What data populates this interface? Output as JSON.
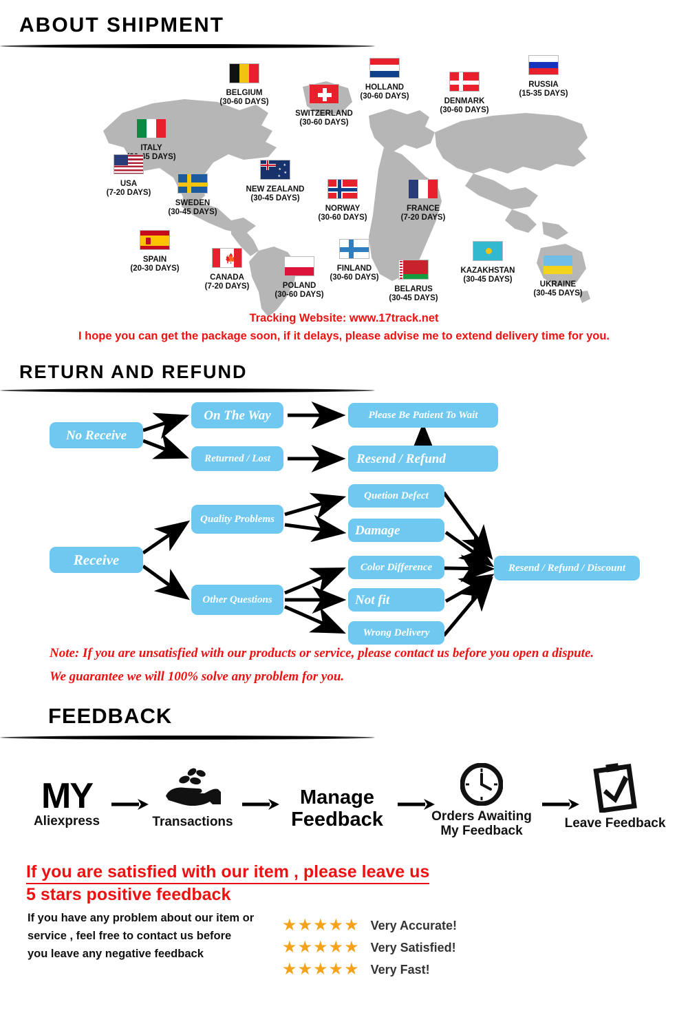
{
  "sections": {
    "shipment_title": "ABOUT  SHIPMENT",
    "return_title": "RETURN AND REFUND",
    "feedback_title": "FEEDBACK"
  },
  "map": {
    "countries": [
      {
        "name": "ITALY",
        "days": "(30-45 DAYS)",
        "flag": "italy"
      },
      {
        "name": "BELGIUM",
        "days": "(30-60 DAYS)",
        "flag": "belgium"
      },
      {
        "name": "SWITZERLAND",
        "days": "(30-60 DAYS)",
        "flag": "switzerland"
      },
      {
        "name": "HOLLAND",
        "days": "(30-60 DAYS)",
        "flag": "holland"
      },
      {
        "name": "DENMARK",
        "days": "(30-60 DAYS)",
        "flag": "denmark"
      },
      {
        "name": "RUSSIA",
        "days": "(15-35 DAYS)",
        "flag": "russia"
      },
      {
        "name": "USA",
        "days": "(7-20 DAYS)",
        "flag": "usa"
      },
      {
        "name": "SWEDEN",
        "days": "(30-45 DAYS)",
        "flag": "sweden"
      },
      {
        "name": "NEW ZEALAND",
        "days": "(30-45 DAYS)",
        "flag": "new-zealand"
      },
      {
        "name": "NORWAY",
        "days": "(30-60 DAYS)",
        "flag": "norway"
      },
      {
        "name": "FRANCE",
        "days": "(7-20 DAYS)",
        "flag": "france"
      },
      {
        "name": "SPAIN",
        "days": "(20-30 DAYS)",
        "flag": "spain"
      },
      {
        "name": "CANADA",
        "days": "(7-20 DAYS)",
        "flag": "canada"
      },
      {
        "name": "POLAND",
        "days": "(30-60 DAYS)",
        "flag": "poland"
      },
      {
        "name": "FINLAND",
        "days": "(30-60 DAYS)",
        "flag": "finland"
      },
      {
        "name": "BELARUS",
        "days": "(30-45 DAYS)",
        "flag": "belarus"
      },
      {
        "name": "KAZAKHSTAN",
        "days": "(30-45 DAYS)",
        "flag": "kazakhstan"
      },
      {
        "name": "UKRAINE",
        "days": "(30-45 DAYS)",
        "flag": "ukraine"
      }
    ],
    "tracking_line": "Tracking Website: www.17track.net",
    "hope_line": "I hope you can get the package soon, if it delays, please advise me to extend delivery time for you."
  },
  "flow": {
    "nodes": [
      {
        "id": "no-receive",
        "label": "No Receive"
      },
      {
        "id": "on-the-way",
        "label": "On The Way"
      },
      {
        "id": "returned-lost",
        "label": "Returned / Lost"
      },
      {
        "id": "be-patient",
        "label": "Please Be Patient To Wait"
      },
      {
        "id": "resend-refund",
        "label": "Resend / Refund"
      },
      {
        "id": "receive",
        "label": "Receive"
      },
      {
        "id": "quality-problems",
        "label": "Quality Problems"
      },
      {
        "id": "other-questions",
        "label": "Other Questions"
      },
      {
        "id": "quetion-defect",
        "label": "Quetion Defect"
      },
      {
        "id": "damage",
        "label": "Damage"
      },
      {
        "id": "color-difference",
        "label": "Color Difference"
      },
      {
        "id": "not-fit",
        "label": "Not fit"
      },
      {
        "id": "wrong-delivery",
        "label": "Wrong Delivery"
      },
      {
        "id": "resend-refund-discount",
        "label": "Resend / Refund / Discount"
      }
    ],
    "note_line1": "Note: If you are unsatisfied with our products or service, please contact us before you open a dispute.",
    "note_line2": "We guarantee we will 100% solve any problem for you."
  },
  "feedback": {
    "steps": [
      {
        "icon": "my-aliexpress-wordmark",
        "line1": "MY",
        "line2": "Aliexpress"
      },
      {
        "icon": "hand-coins-icon",
        "line1": "",
        "line2": "Transactions"
      },
      {
        "icon": "manage-feedback-text",
        "line1": "Manage",
        "line2": "Feedback"
      },
      {
        "icon": "clock-icon",
        "line1": "Orders Awaiting",
        "line2": "My Feedback"
      },
      {
        "icon": "clipboard-check-icon",
        "line1": "",
        "line2": "Leave Feedback"
      }
    ],
    "red_line1": "If you are satisfied with our item , please leave us",
    "red_line2": "5 stars positive feedback",
    "paragraph": "If you have any problem about our item or service , feel free to contact us before you  leave any negative feedback",
    "ratings": [
      {
        "stars": "★★★★★",
        "text": "Very Accurate!"
      },
      {
        "stars": "★★★★★",
        "text": "Very Satisfied!"
      },
      {
        "stars": "★★★★★",
        "text": "Very Fast!"
      }
    ]
  },
  "colors": {
    "node_blue": "#6ec8ef",
    "red": "#ee1111",
    "star_orange": "#F5A21D",
    "map_gray": "#b5b5b5"
  }
}
